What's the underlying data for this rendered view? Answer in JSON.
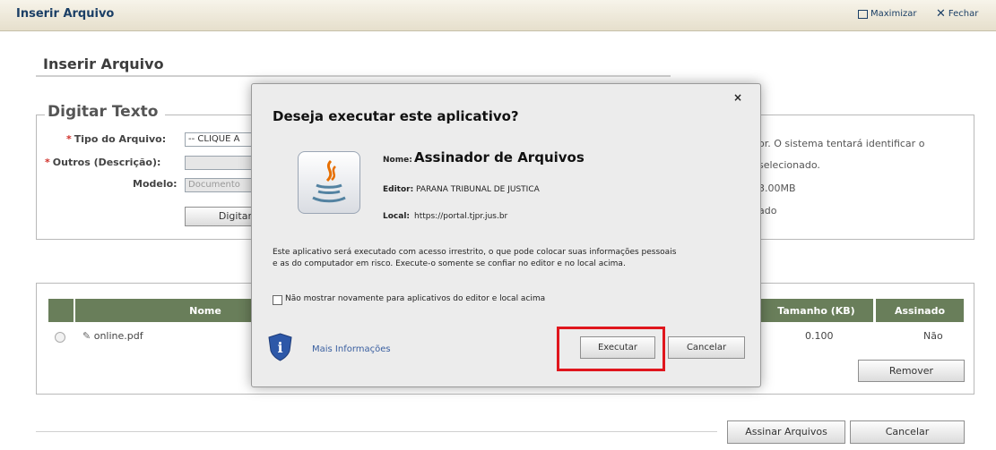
{
  "window": {
    "title": "Inserir Arquivo",
    "maximize_label": "Maximizar",
    "close_label": "Fechar"
  },
  "page": {
    "title": "Inserir Arquivo"
  },
  "form": {
    "legend": "Digitar Texto",
    "tipo_label": "Tipo do Arquivo:",
    "tipo_value": "-- CLIQUE A",
    "outros_label": "Outros (Descrição):",
    "outros_value": "",
    "modelo_label": "Modelo:",
    "modelo_value": "Documento",
    "digitar_button": "Digitar",
    "right_text": [
      "or. O sistema tentará identificar o",
      "selecionado.",
      "3.00MB",
      "ado"
    ]
  },
  "table": {
    "headers": {
      "nome": "Nome",
      "tamanho": "Tamanho (KB)",
      "assinado": "Assinado"
    },
    "rows": [
      {
        "nome": "online.pdf",
        "tamanho": "0.100",
        "assinado": "Não"
      }
    ],
    "remove_button": "Remover"
  },
  "footer": {
    "assinar_button": "Assinar Arquivos",
    "cancel_button": "Cancelar"
  },
  "dialog": {
    "close": "×",
    "title": "Deseja executar este aplicativo?",
    "name_label": "Nome:",
    "name_value": "Assinador de Arquivos",
    "editor_label": "Editor:",
    "editor_value": "PARANA TRIBUNAL DE JUSTICA",
    "local_label": "Local:",
    "local_value": "https://portal.tjpr.jus.br",
    "warning_line1": "Este aplicativo será executado com acesso irrestrito, o que pode colocar suas informações pessoais",
    "warning_line2": "e as do computador em risco. Execute-o somente se confiar no editor e no local acima.",
    "checkbox_label": "Não mostrar novamente para aplicativos do editor e local acima",
    "more_info": "Mais Informações",
    "run_button": "Executar",
    "cancel_button": "Cancelar"
  },
  "colors": {
    "header_green": "#697e5a",
    "highlight_red": "#e0161d",
    "title_blue": "#1b3f66"
  }
}
